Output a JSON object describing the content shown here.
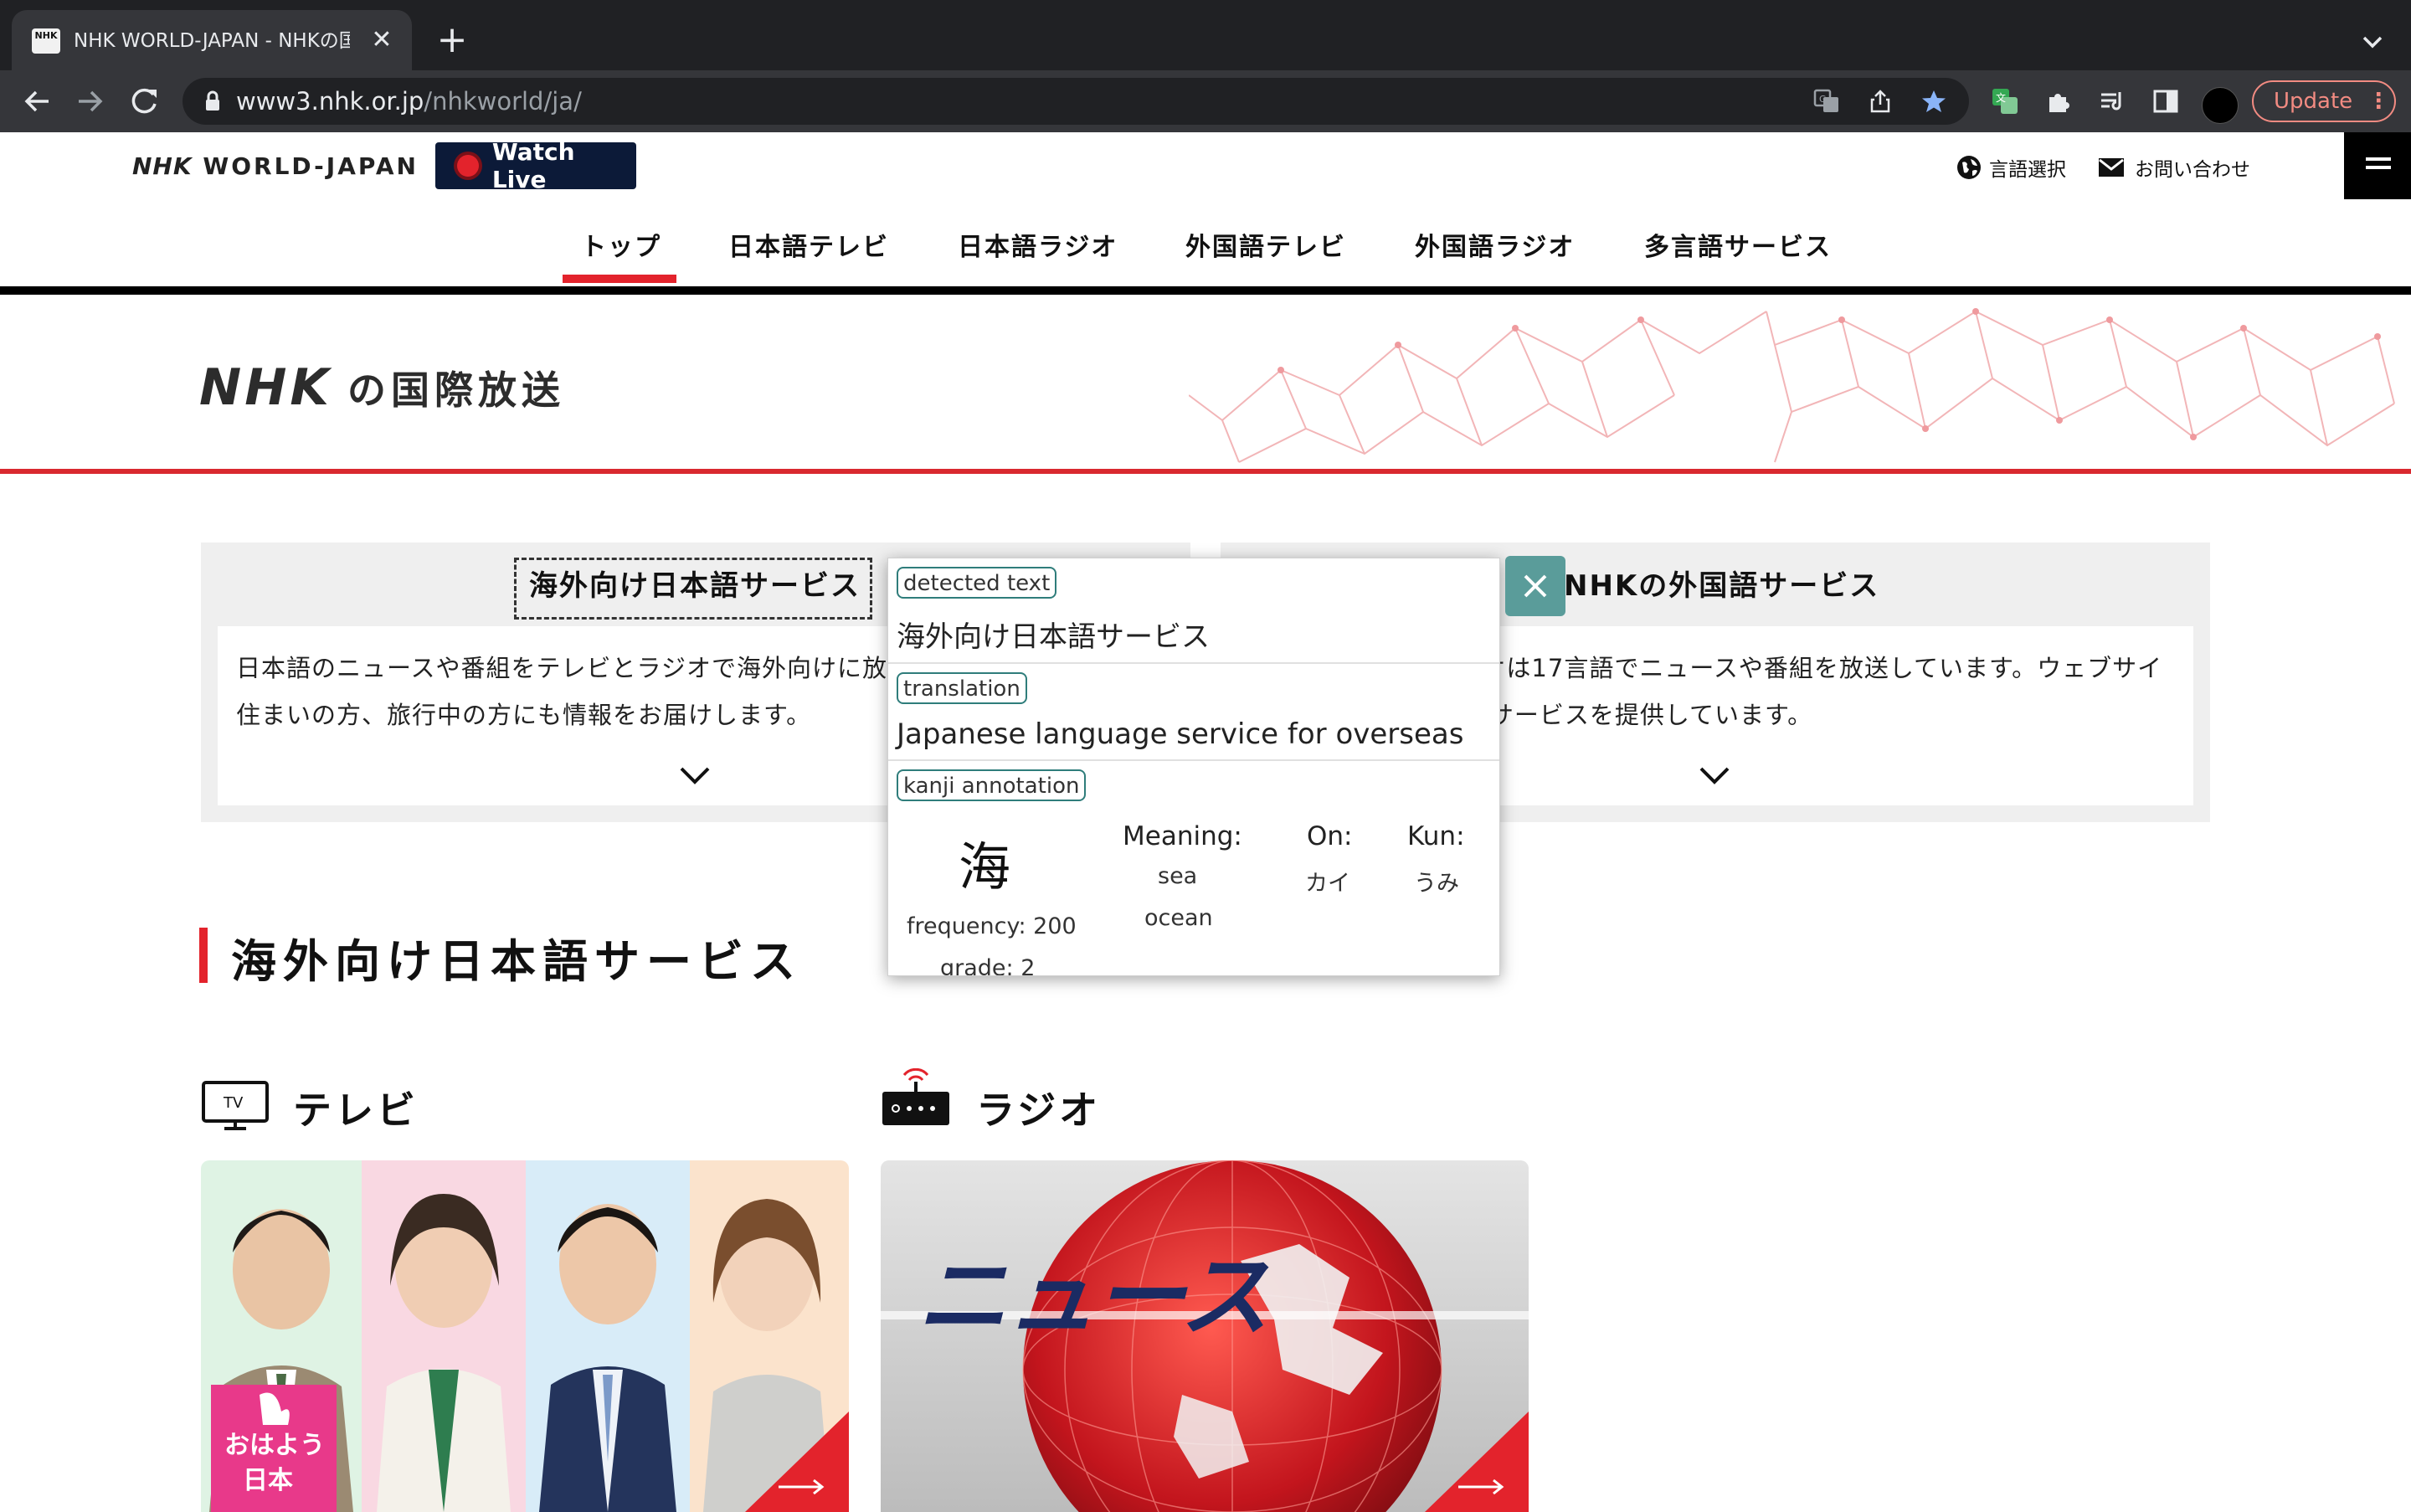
{
  "browser": {
    "tab_title": "NHK WORLD-JAPAN - NHKの国",
    "favicon_text": "NHK",
    "url_host": "www3.nhk.or.jp",
    "url_path": "/nhkworld/ja/",
    "update_label": "Update"
  },
  "header": {
    "logo_nhk": "NHK",
    "logo_rest": "WORLD-JAPAN",
    "watch_live": "Watch Live",
    "lang_select": "言語選択",
    "contact": "お問い合わせ"
  },
  "nav": {
    "items": [
      "トップ",
      "日本語テレビ",
      "日本語ラジオ",
      "外国語テレビ",
      "外国語ラジオ",
      "多言語サービス"
    ],
    "active_index": 0
  },
  "hero": {
    "nhk": "NHK",
    "rest": "の国際放送"
  },
  "cards": [
    {
      "title": "海外向け日本語サービス",
      "desc": "日本語のニュースや番組をテレビとラジオで海外向けに放送しています。海外にお住まいの方、旅行中の方にも情報をお届けします。"
    },
    {
      "title": "NHKの外国語サービス",
      "desc": "テレビは英語、ラジオは17言語でニュースや番組を放送しています。ウェブサイトでは、全19言語でサービスを提供しています。"
    }
  ],
  "section": {
    "title": "海外向け日本語サービス",
    "tv_label": "テレビ",
    "tv_icon_text": "TV",
    "radio_label": "ラジオ"
  },
  "tiles": {
    "tv_badge_line1": "おはよう",
    "tv_badge_line2": "日本",
    "radio_headline": "ニュース"
  },
  "popup": {
    "detected_tag": "detected text",
    "detected_text": "海外向け日本語サービス",
    "translation_tag": "translation",
    "translation_text": "Japanese language service for overseas",
    "kanji_tag": "kanji annotation",
    "kanji": "海",
    "frequency": "frequency: 200",
    "grade": "grade: 2",
    "meaning_head": "Meaning:",
    "meaning_1": "sea",
    "meaning_2": "ocean",
    "on_head": "On:",
    "on_val": "カイ",
    "kun_head": "Kun:",
    "kun_val": "うみ"
  },
  "colors": {
    "nhk_red": "#e3232c",
    "navy": "#0c1a38",
    "teal": "#5a9c9a",
    "chrome_dark": "#202124",
    "update_red": "#f28b82"
  }
}
